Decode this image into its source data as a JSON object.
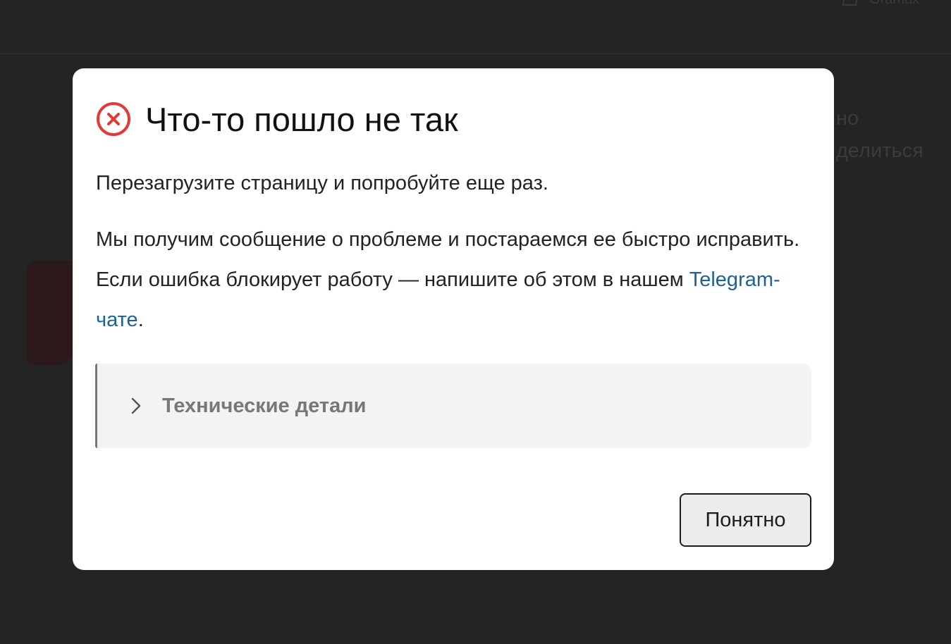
{
  "background": {
    "logo_text": "Gramax",
    "text_line_1": "но",
    "text_line_2": "делиться"
  },
  "dialog": {
    "title": "Что-то пошло не так",
    "icon": "error-circle-x-icon",
    "paragraph1": "Перезагрузите страницу и попробуйте еще раз.",
    "paragraph2_before_link": "Мы получим сообщение о проблеме и постараемся ее быстро исправить. Если ошибка блокирует работу — напишите об этом в нашем ",
    "link_text": "Telegram-чате",
    "paragraph2_after_link": ".",
    "details_label": "Технические детали",
    "details_icon": "chevron-right-icon",
    "ok_label": "Понятно"
  },
  "colors": {
    "error": "#e53935",
    "link": "#1e6196",
    "backdrop": "#242424"
  }
}
